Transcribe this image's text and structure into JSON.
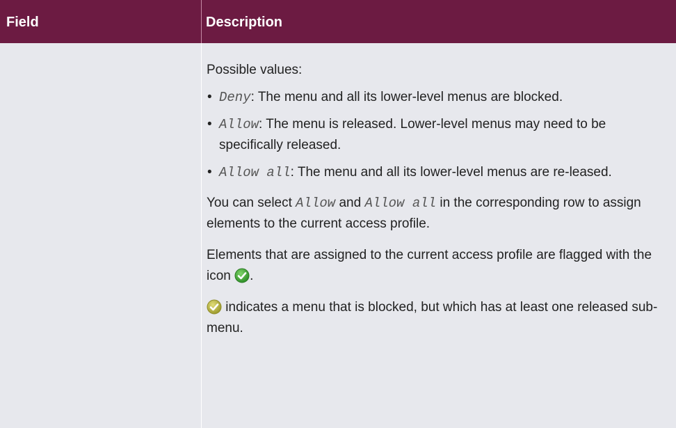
{
  "table": {
    "header": {
      "field": "Field",
      "description": "Description"
    },
    "row": {
      "field": "",
      "intro": "Possible values:",
      "values": [
        {
          "code": "Deny",
          "text": ": The menu and all its lower-level menus are blocked."
        },
        {
          "code": "Allow",
          "text": ": The menu is released. Lower-level menus may need to be specifically released."
        },
        {
          "code": "Allow all",
          "text": ": The menu and all its lower-level menus are re-leased."
        }
      ],
      "select_note": {
        "before": "You can select ",
        "code1": "Allow",
        "middle": " and ",
        "code2": "Allow all",
        "after": " in the corresponding row to assign elements to the current access profile."
      },
      "assigned_note": {
        "before": "Elements that are assigned to the current access profile are flagged with the icon ",
        "after": "."
      },
      "blocked_note": {
        "text": " indicates a menu that is blocked, but which has at least one released sub-menu."
      }
    }
  },
  "icons": {
    "assigned": "check-circle-green-icon",
    "partially_released": "check-circle-olive-icon"
  },
  "colors": {
    "header_bg": "#6c1b42",
    "row_bg": "#e7e8ed",
    "icon_green": "#3ea534",
    "icon_olive": "#b6b33f"
  }
}
